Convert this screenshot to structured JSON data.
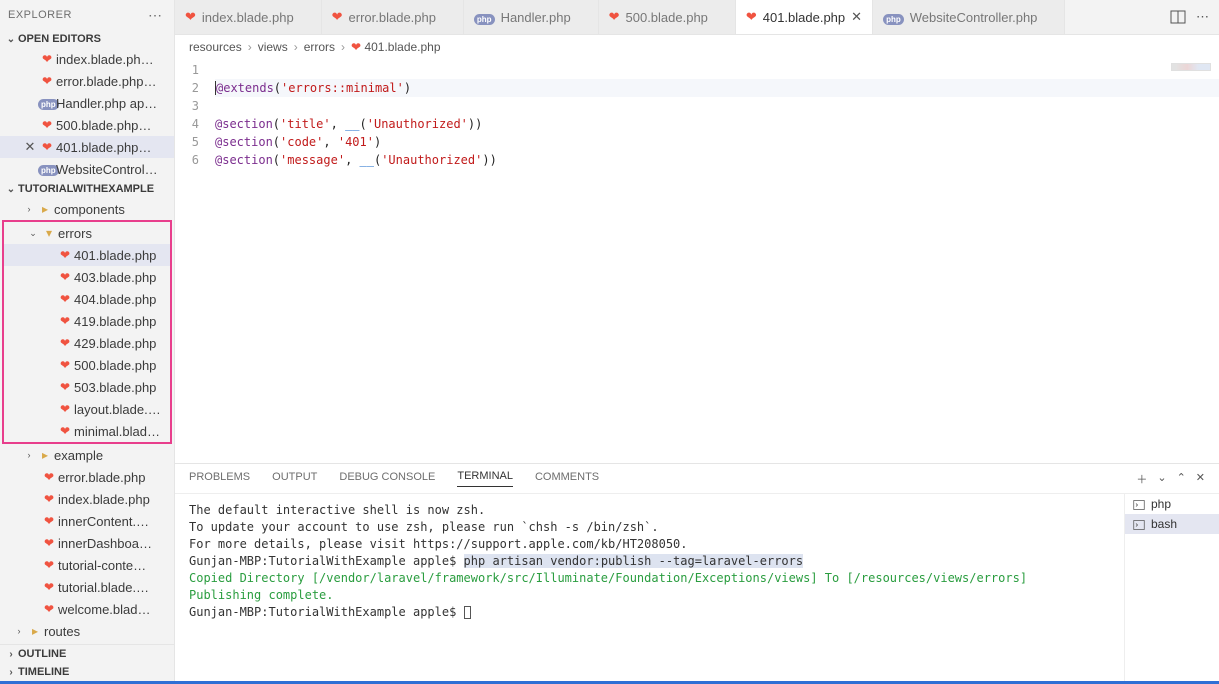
{
  "sidebar": {
    "title": "EXPLORER",
    "openEditorsLabel": "OPEN EDITORS",
    "projectLabel": "TUTORIALWITHEXAMPLE",
    "openEditors": [
      {
        "label": "index.blade.ph…",
        "icon": "laravel"
      },
      {
        "label": "error.blade.php…",
        "icon": "laravel"
      },
      {
        "label": "Handler.php ap…",
        "icon": "php"
      },
      {
        "label": "500.blade.php…",
        "icon": "laravel"
      },
      {
        "label": "401.blade.php…",
        "icon": "laravel",
        "active": true
      },
      {
        "label": "WebsiteControl…",
        "icon": "php"
      }
    ],
    "tree": {
      "components": "components",
      "errors": "errors",
      "errorFiles": [
        "401.blade.php",
        "403.blade.php",
        "404.blade.php",
        "419.blade.php",
        "429.blade.php",
        "500.blade.php",
        "503.blade.php",
        "layout.blade.…",
        "minimal.blad…"
      ],
      "example": "example",
      "otherFiles": [
        "error.blade.php",
        "index.blade.php",
        "innerContent.…",
        "innerDashboa…",
        "tutorial-conte…",
        "tutorial.blade.…",
        "welcome.blad…"
      ],
      "routes": "routes"
    },
    "outline": "OUTLINE",
    "timeline": "TIMELINE"
  },
  "tabs": [
    {
      "label": "index.blade.php",
      "icon": "laravel"
    },
    {
      "label": "error.blade.php",
      "icon": "laravel"
    },
    {
      "label": "Handler.php",
      "icon": "php"
    },
    {
      "label": "500.blade.php",
      "icon": "laravel"
    },
    {
      "label": "401.blade.php",
      "icon": "laravel",
      "active": true
    },
    {
      "label": "WebsiteController.php",
      "icon": "php"
    }
  ],
  "breadcrumb": [
    "resources",
    "views",
    "errors",
    "401.blade.php"
  ],
  "code": {
    "lines": [
      1,
      2,
      3,
      4,
      5,
      6
    ],
    "l1_dir": "@extends",
    "l1_str": "'errors::minimal'",
    "l3_dir": "@section",
    "l3_s1": "'title'",
    "l3_fn": "__",
    "l3_s2": "'Unauthorized'",
    "l4_dir": "@section",
    "l4_s1": "'code'",
    "l4_s2": "'401'",
    "l5_dir": "@section",
    "l5_s1": "'message'",
    "l5_fn": "__",
    "l5_s2": "'Unauthorized'"
  },
  "panel": {
    "tabs": [
      "PROBLEMS",
      "OUTPUT",
      "DEBUG CONSOLE",
      "TERMINAL",
      "COMMENTS"
    ],
    "activeTab": "TERMINAL",
    "termItems": [
      "php",
      "bash"
    ],
    "termActive": "bash",
    "t1": "The default interactive shell is now zsh.",
    "t2": "To update your account to use zsh, please run `chsh -s /bin/zsh`.",
    "t3": "For more details, please visit https://support.apple.com/kb/HT208050.",
    "t4a": "Gunjan-MBP:TutorialWithExample apple$ ",
    "t4b": "php artisan vendor:publish --tag=laravel-errors",
    "t5": "Copied Directory [/vendor/laravel/framework/src/Illuminate/Foundation/Exceptions/views] To [/resources/views/errors]",
    "t6": "Publishing complete.",
    "t7": "Gunjan-MBP:TutorialWithExample apple$ "
  }
}
